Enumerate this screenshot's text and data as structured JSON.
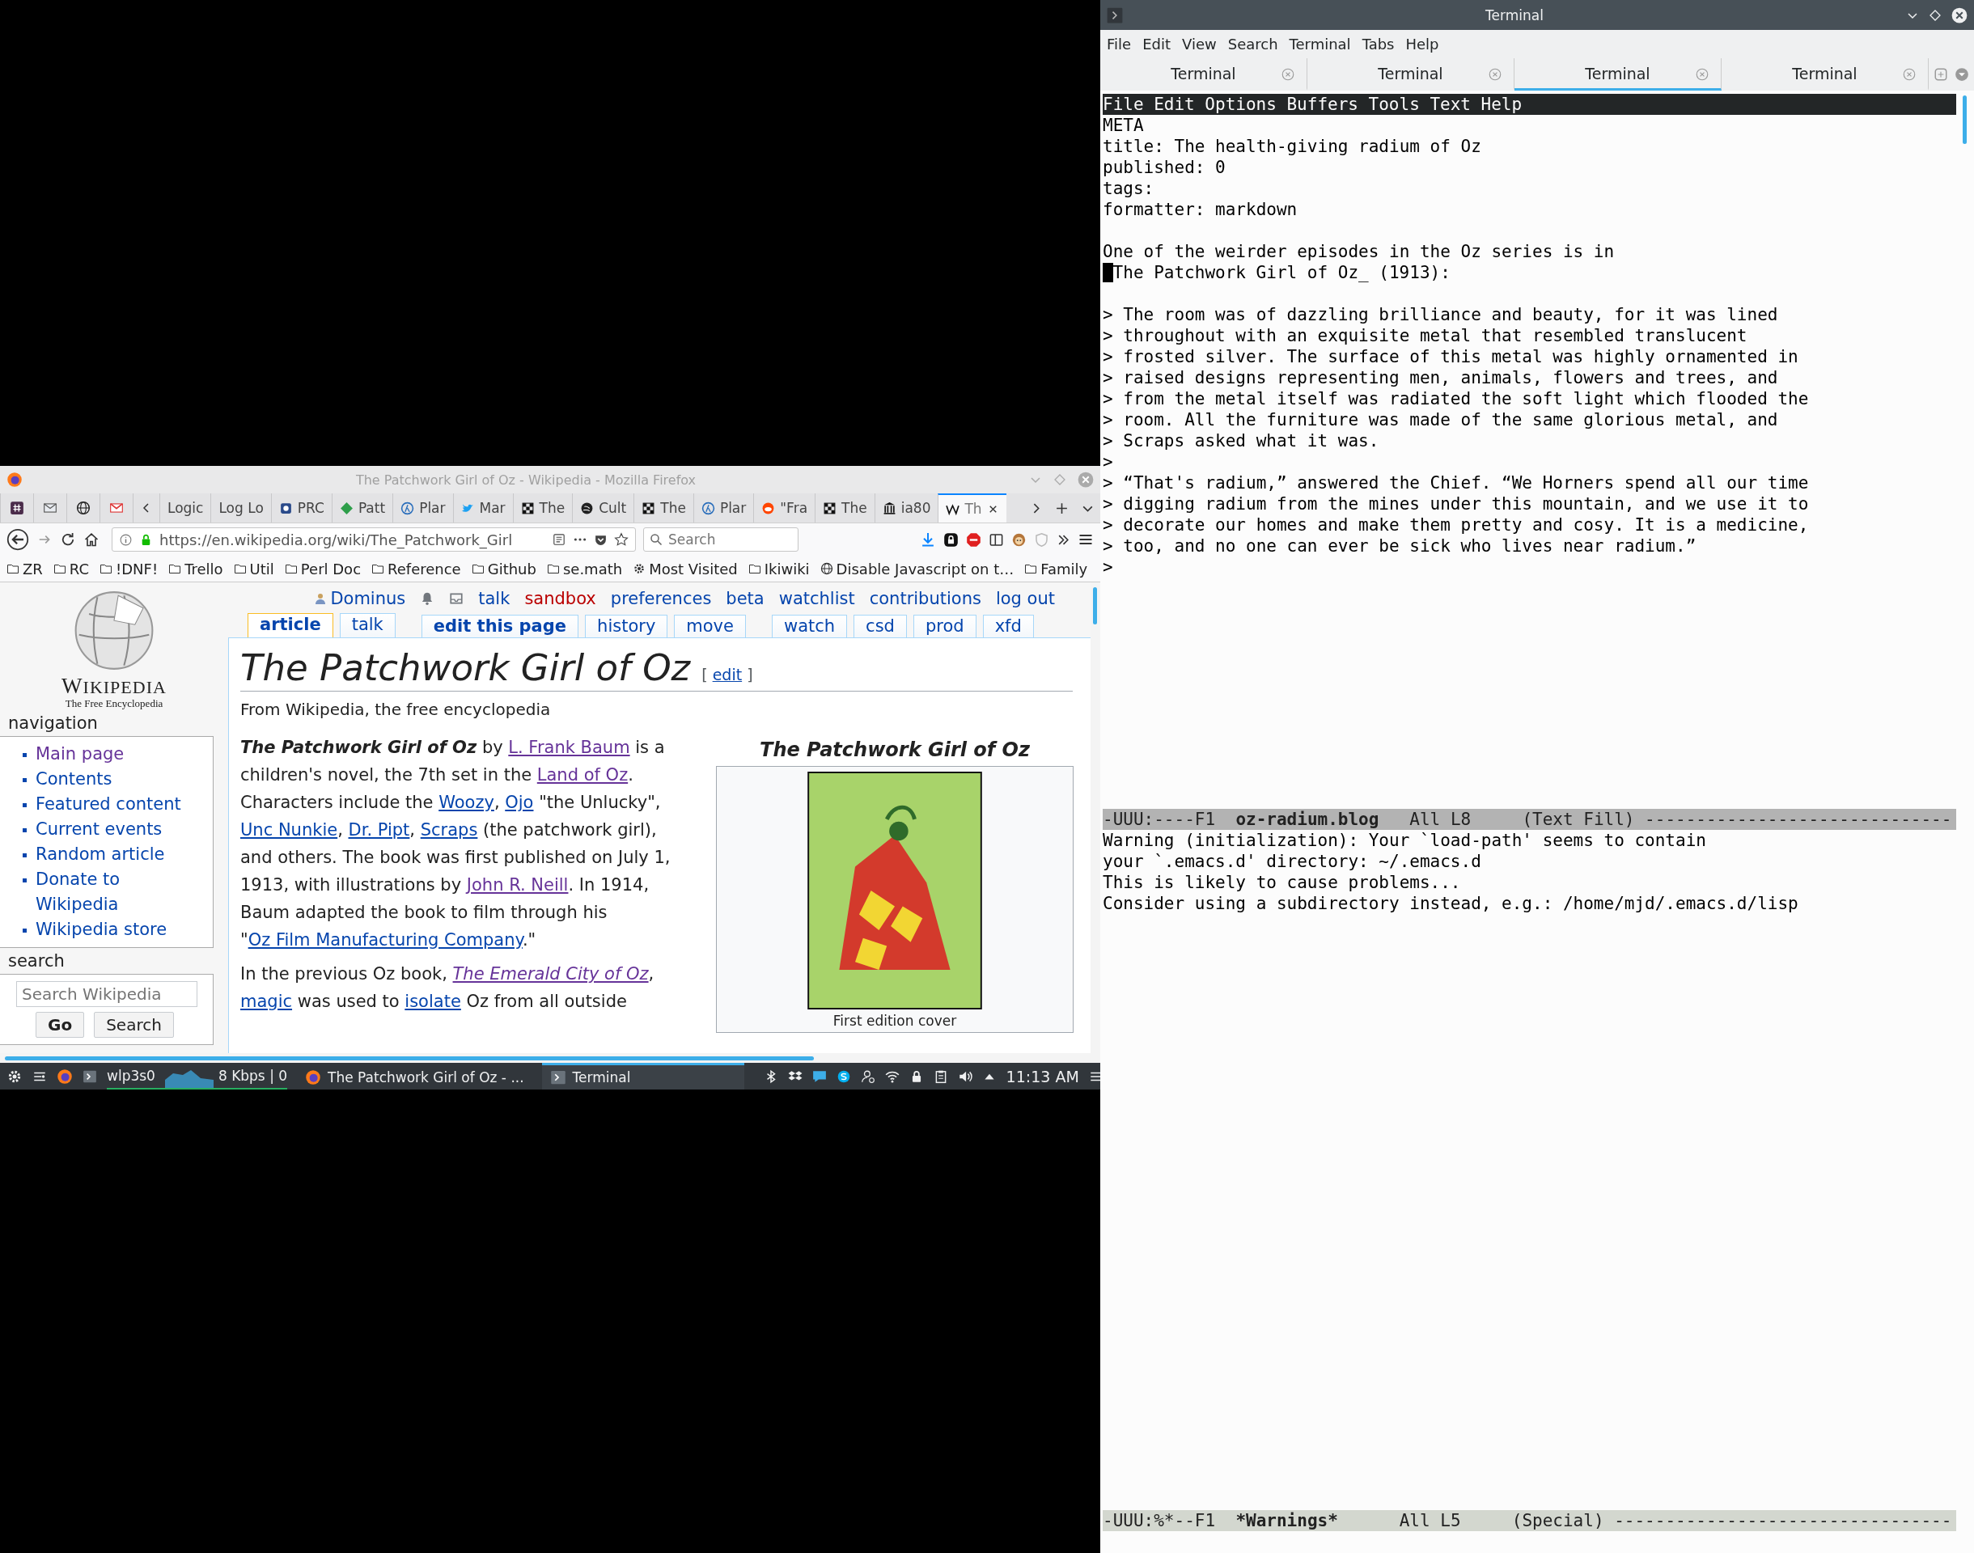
{
  "firefox": {
    "title": "The Patchwork Girl of Oz - Wikipedia - Mozilla Firefox",
    "tabs": [
      {
        "kind": "pinned",
        "selected": false
      },
      {
        "kind": "pinned",
        "selected": false
      },
      {
        "kind": "pinned",
        "selected": false
      },
      {
        "kind": "pinned",
        "selected": false
      },
      {
        "kind": "tab",
        "label": "Logic",
        "selected": false
      },
      {
        "kind": "tab",
        "label": "Log Lo",
        "selected": false
      },
      {
        "kind": "tab",
        "label": "PRC",
        "selected": false
      },
      {
        "kind": "tab",
        "label": "Patt",
        "selected": false
      },
      {
        "kind": "tab",
        "label": "Plar",
        "selected": false
      },
      {
        "kind": "tab",
        "label": "Mar",
        "selected": false
      },
      {
        "kind": "tab",
        "label": "The",
        "selected": false
      },
      {
        "kind": "tab",
        "label": "Cult",
        "selected": false
      },
      {
        "kind": "tab",
        "label": "The",
        "selected": false
      },
      {
        "kind": "tab",
        "label": "Plar",
        "selected": false
      },
      {
        "kind": "tab",
        "label": "\"Fra",
        "selected": false
      },
      {
        "kind": "tab",
        "label": "The",
        "selected": false
      },
      {
        "kind": "tab",
        "label": "ia80",
        "selected": false
      },
      {
        "kind": "tab",
        "label": "Th",
        "selected": true
      }
    ],
    "url": "https://en.wikipedia.org/wiki/The_Patchwork_Girl",
    "search_placeholder": "Search",
    "bookmarks": [
      "ZR",
      "RC",
      "!DNF!",
      "Trello",
      "Util",
      "Perl Doc",
      "Reference",
      "Github",
      "se.math",
      "Most Visited",
      "Ikiwiki",
      "Disable Javascript on t…",
      "Family"
    ]
  },
  "wiki": {
    "wordmark": "WIKIPEDIA",
    "tagline": "The Free Encyclopedia",
    "personal": [
      {
        "kind": "user",
        "label": "Dominus"
      },
      {
        "kind": "bell"
      },
      {
        "kind": "tray"
      },
      {
        "kind": "link",
        "label": "talk"
      },
      {
        "kind": "redlink",
        "label": "sandbox"
      },
      {
        "kind": "link",
        "label": "preferences"
      },
      {
        "kind": "link",
        "label": "beta"
      },
      {
        "kind": "link",
        "label": "watchlist"
      },
      {
        "kind": "link",
        "label": "contributions"
      },
      {
        "kind": "link",
        "label": "log out"
      }
    ],
    "tab_groups": [
      {
        "tabs": [
          {
            "label": "article",
            "selected": true,
            "bold": true
          },
          {
            "label": "talk",
            "selected": false,
            "bold": false
          }
        ]
      },
      {
        "tabs": [
          {
            "label": "edit this page",
            "selected": false,
            "bold": true
          },
          {
            "label": "history",
            "selected": false,
            "bold": false
          },
          {
            "label": "move",
            "selected": false,
            "bold": false
          }
        ]
      },
      {
        "tabs": [
          {
            "label": "watch",
            "selected": false,
            "bold": false
          },
          {
            "label": "csd",
            "selected": false,
            "bold": false
          },
          {
            "label": "prod",
            "selected": false,
            "bold": false
          },
          {
            "label": "xfd",
            "selected": false,
            "bold": false
          }
        ]
      }
    ],
    "navigation": {
      "heading": "navigation",
      "items": [
        {
          "label": "Main page",
          "visited": true
        },
        {
          "label": "Contents",
          "visited": false
        },
        {
          "label": "Featured content",
          "visited": false
        },
        {
          "label": "Current events",
          "visited": false
        },
        {
          "label": "Random article",
          "visited": false
        },
        {
          "label": "Donate to Wikipedia",
          "visited": false
        },
        {
          "label": "Wikipedia store",
          "visited": false
        }
      ]
    },
    "search": {
      "heading": "search",
      "placeholder": "Search Wikipedia",
      "go": "Go",
      "button": "Search"
    },
    "article": {
      "title": "The Patchwork Girl of Oz",
      "edit_open": "[",
      "edit": "edit",
      "edit_close": "]",
      "tagline": "From Wikipedia, the free encyclopedia",
      "paragraphs": [
        {
          "segments": [
            {
              "kind": "title",
              "text": "The Patchwork Girl of Oz"
            },
            {
              "kind": "text",
              "text": " by "
            },
            {
              "kind": "link",
              "text": "L. Frank Baum",
              "visited": true
            },
            {
              "kind": "text",
              "text": " is a children's novel, the 7th set in the "
            },
            {
              "kind": "link",
              "text": "Land of Oz",
              "visited": true
            },
            {
              "kind": "text",
              "text": ". Characters include the "
            },
            {
              "kind": "link",
              "text": "Woozy",
              "visited": false
            },
            {
              "kind": "text",
              "text": ", "
            },
            {
              "kind": "link",
              "text": "Ojo",
              "visited": false
            },
            {
              "kind": "text",
              "text": " \"the Unlucky\", "
            },
            {
              "kind": "link",
              "text": "Unc Nunkie",
              "visited": false
            },
            {
              "kind": "text",
              "text": ", "
            },
            {
              "kind": "link",
              "text": "Dr. Pipt",
              "visited": false
            },
            {
              "kind": "text",
              "text": ", "
            },
            {
              "kind": "link",
              "text": "Scraps",
              "visited": false
            },
            {
              "kind": "text",
              "text": " (the patchwork girl), and others. The book was first published on July 1, 1913, with illustrations by "
            },
            {
              "kind": "link",
              "text": "John R. Neill",
              "visited": true
            },
            {
              "kind": "text",
              "text": ". In 1914, Baum adapted the book to film through his \""
            },
            {
              "kind": "link",
              "text": "Oz Film Manufacturing Company",
              "visited": false
            },
            {
              "kind": "text",
              "text": ".\""
            }
          ]
        },
        {
          "segments": [
            {
              "kind": "text",
              "text": "In the previous Oz book, "
            },
            {
              "kind": "italic-link",
              "text": "The Emerald City of Oz",
              "visited": true
            },
            {
              "kind": "text",
              "text": ", "
            },
            {
              "kind": "link",
              "text": "magic",
              "visited": false
            },
            {
              "kind": "text",
              "text": " was used to "
            },
            {
              "kind": "link",
              "text": "isolate",
              "visited": false
            },
            {
              "kind": "text",
              "text": " Oz from all outside"
            }
          ]
        }
      ],
      "infobox": {
        "title": "The Patchwork Girl of Oz",
        "caption": "First edition cover"
      }
    }
  },
  "taskbar": {
    "network": {
      "interface": "wlp3s0",
      "rate": "8 Kbps | 0"
    },
    "tasks": [
      {
        "label": "The Patchwork Girl of Oz - ...",
        "selected": false
      },
      {
        "label": "Terminal",
        "selected": true
      }
    ],
    "clock": "11:13 AM"
  },
  "terminal": {
    "title": "Terminal",
    "menu": [
      "File",
      "Edit",
      "View",
      "Search",
      "Terminal",
      "Tabs",
      "Help"
    ],
    "tabs": [
      {
        "label": "Terminal",
        "selected": false
      },
      {
        "label": "Terminal",
        "selected": false
      },
      {
        "label": "Terminal",
        "selected": true
      },
      {
        "label": "Terminal",
        "selected": false
      }
    ],
    "emacs": {
      "menu": [
        "File",
        "Edit",
        "Options",
        "Buffers",
        "Tools",
        "Text",
        "Help"
      ],
      "paragraphs": [
        {
          "lines": [
            "META",
            "title: The health-giving radium of Oz",
            "published: 0",
            "tags:",
            "formatter: markdown"
          ],
          "cursor": false
        },
        {
          "lines": [
            "One of the weirder episodes in the Oz series is in",
            "The Patchwork Girl of Oz_ (1913):"
          ],
          "cursor": true
        },
        {
          "lines": [
            "> The room was of dazzling brilliance and beauty, for it was lined",
            "> throughout with an exquisite metal that resembled translucent",
            "> frosted silver. The surface of this metal was highly ornamented in",
            "> raised designs representing men, animals, flowers and trees, and",
            "> from the metal itself was radiated the soft light which flooded the",
            "> room. All the furniture was made of the same glorious metal, and",
            "> Scraps asked what it was.",
            ">",
            "> “That's radium,” answered the Chief. “We Horners spend all our time",
            "> digging radium from the mines under this mountain, and we use it to",
            "> decorate our homes and make them pretty and cosy. It is a medicine,",
            "> too, and no one can ever be sick who lives near radium.”",
            ">"
          ],
          "cursor": false
        }
      ],
      "modeline": {
        "status": "-UUU:----F1",
        "buffer": "oz-radium.blog",
        "position": "All L8",
        "mode": "(Text Fill)",
        "fill": "------------------------------"
      },
      "warnings": [
        "Warning (initialization): Your `load-path' seems to contain",
        "your `.emacs.d' directory: ~/.emacs.d",
        "This is likely to cause problems...",
        "Consider using a subdirectory instead, e.g.: /home/mjd/.emacs.d/lisp"
      ],
      "warnings_modeline": {
        "status": "-UUU:%*--F1",
        "buffer": "*Warnings*",
        "position": "All L5",
        "mode": "(Special)",
        "fill": "---------------------------------"
      }
    }
  }
}
